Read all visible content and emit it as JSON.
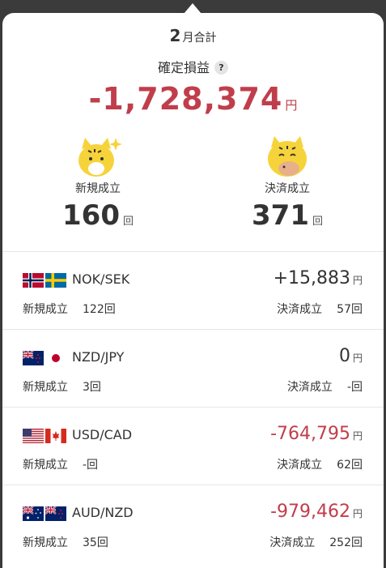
{
  "summary": {
    "month_num": "2",
    "month_suffix": "月合計",
    "pl_label": "確定損益",
    "help_icon": "?",
    "pl_value": "-1,728,374",
    "pl_unit": "円",
    "new_label": "新規成立",
    "new_count": "160",
    "settle_label": "決済成立",
    "settle_count": "371",
    "count_unit": "回"
  },
  "colors": {
    "negative": "#c03e4b",
    "text": "#333333"
  },
  "pairs": [
    {
      "name": "NOK/SEK",
      "value": "+15,883",
      "unit": "円",
      "sign": "positive",
      "new_label": "新規成立",
      "new_count": "122回",
      "settle_label": "決済成立",
      "settle_count": "57回",
      "flags": [
        "norway-flag-icon",
        "sweden-flag-icon"
      ]
    },
    {
      "name": "NZD/JPY",
      "value": "0",
      "unit": "円",
      "sign": "zero",
      "new_label": "新規成立",
      "new_count": "3回",
      "settle_label": "決済成立",
      "settle_count": "-回",
      "flags": [
        "new-zealand-flag-icon",
        "japan-flag-icon"
      ]
    },
    {
      "name": "USD/CAD",
      "value": "-764,795",
      "unit": "円",
      "sign": "negative",
      "new_label": "新規成立",
      "new_count": "-回",
      "settle_label": "決済成立",
      "settle_count": "62回",
      "flags": [
        "us-flag-icon",
        "canada-flag-icon"
      ]
    },
    {
      "name": "AUD/NZD",
      "value": "-979,462",
      "unit": "円",
      "sign": "negative",
      "new_label": "新規成立",
      "new_count": "35回",
      "settle_label": "決済成立",
      "settle_count": "252回",
      "flags": [
        "australia-flag-icon",
        "new-zealand-flag-icon"
      ]
    }
  ]
}
